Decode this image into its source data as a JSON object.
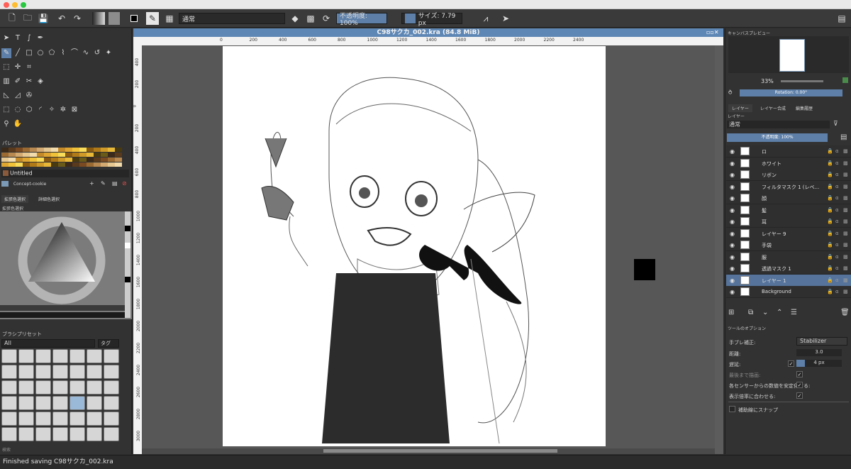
{
  "window": {
    "title": ""
  },
  "toolbar": {
    "blend_mode": "通常",
    "opacity_label": "不透明度: 100%",
    "size_label": "サイズ: 7.79 px"
  },
  "left_panel": {
    "palette_title": "パレット",
    "palette_name": "Untitled",
    "palette_resource": "Concept-cookie",
    "color_tabs": [
      "拡張色選択",
      "詳細色選択"
    ],
    "color_selector_title": "拡張色選択",
    "brush_preset_title": "ブラシプリセット",
    "brush_filter": "All",
    "brush_tag": "タグ",
    "search_label": "検索"
  },
  "canvas": {
    "document_title": "C98サクカ_002.kra (84.8 MiB)",
    "ruler_h_ticks": [
      "0",
      "200",
      "400",
      "600",
      "800",
      "1000",
      "1200",
      "1400",
      "1600",
      "1800",
      "2000",
      "2200",
      "2400"
    ],
    "ruler_v_ticks": [
      "400",
      "200",
      "0",
      "200",
      "400",
      "600",
      "800",
      "1000",
      "1200",
      "1400",
      "1600",
      "1800",
      "2000",
      "2200",
      "2400",
      "2600",
      "2800",
      "3000"
    ]
  },
  "right_panel": {
    "preview_title": "キャンバスプレビュー",
    "zoom": "33%",
    "rotation": "Rotation: 0.00°",
    "tabs": [
      "レイヤー",
      "レイヤー合成",
      "編集履歴"
    ],
    "layers_title": "レイヤー",
    "blend_mode": "通常",
    "opacity": "不透明度: 100%",
    "layers": [
      {
        "name": "ロ",
        "selected": false
      },
      {
        "name": "ホワイト",
        "selected": false
      },
      {
        "name": "リボン",
        "selected": false
      },
      {
        "name": "フィルタマスク 1 (レベ...",
        "selected": false
      },
      {
        "name": "顔",
        "selected": false
      },
      {
        "name": "髪",
        "selected": false
      },
      {
        "name": "耳",
        "selected": false
      },
      {
        "name": "レイヤー 9",
        "selected": false
      },
      {
        "name": "手袋",
        "selected": false
      },
      {
        "name": "服",
        "selected": false
      },
      {
        "name": "透過マスク 1",
        "selected": false
      },
      {
        "name": "レイヤー 1",
        "selected": true
      },
      {
        "name": "Background",
        "selected": false
      }
    ],
    "tool_options_title": "ツールのオプション",
    "stabilizer_label": "手ブレ補正:",
    "stabilizer_value": "Stabilizer",
    "distance_label": "距離:",
    "distance_value": "3.0",
    "delay_label": "遅延:",
    "delay_value": "4 px",
    "finish_label": "最後まで描画:",
    "stabilize_label": "各センサーからの数値を安定化する:",
    "scale_label": "表示倍率に合わせる:",
    "snap_label": "補助線にスナップ"
  },
  "status": {
    "message": "Finished saving  C98サクカ_002.kra"
  }
}
